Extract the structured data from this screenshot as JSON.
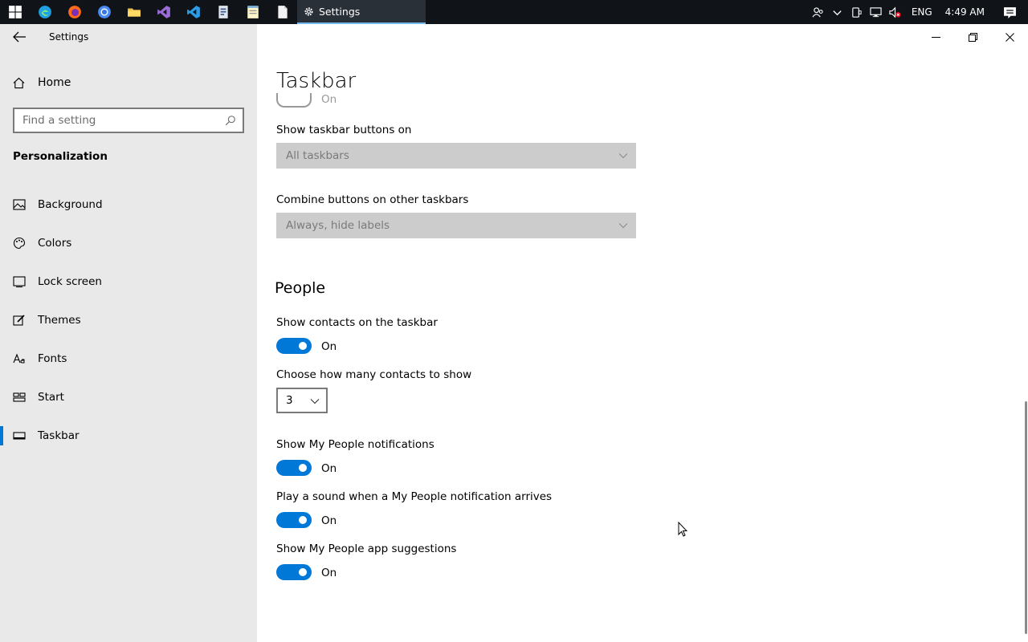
{
  "taskbar": {
    "active_window": "Settings",
    "tray": {
      "language": "ENG",
      "time": "4:49 AM"
    }
  },
  "sidebar": {
    "app_title": "Settings",
    "home_label": "Home",
    "search_placeholder": "Find a setting",
    "section": "Personalization",
    "items": [
      {
        "label": "Background",
        "icon": "image-icon"
      },
      {
        "label": "Colors",
        "icon": "palette-icon"
      },
      {
        "label": "Lock screen",
        "icon": "lock-screen-icon"
      },
      {
        "label": "Themes",
        "icon": "themes-icon"
      },
      {
        "label": "Fonts",
        "icon": "fonts-icon"
      },
      {
        "label": "Start",
        "icon": "start-icon"
      },
      {
        "label": "Taskbar",
        "icon": "taskbar-icon",
        "selected": true
      }
    ]
  },
  "main": {
    "title": "Taskbar",
    "ghost_toggle_label": "On",
    "show_buttons_label": "Show taskbar buttons on",
    "show_buttons_value": "All taskbars",
    "combine_label": "Combine buttons on other taskbars",
    "combine_value": "Always, hide labels",
    "people_heading": "People",
    "settings": [
      {
        "label": "Show contacts on the taskbar",
        "state": "On"
      },
      {
        "label": "Show My People notifications",
        "state": "On"
      },
      {
        "label": "Play a sound when a My People notification arrives",
        "state": "On"
      },
      {
        "label": "Show My People app suggestions",
        "state": "On"
      }
    ],
    "contacts_count_label": "Choose how many contacts to show",
    "contacts_count_value": "3"
  },
  "colors": {
    "accent": "#0078d7",
    "sidebar_bg": "#e9e9e9",
    "taskbar_bg": "#101418"
  }
}
